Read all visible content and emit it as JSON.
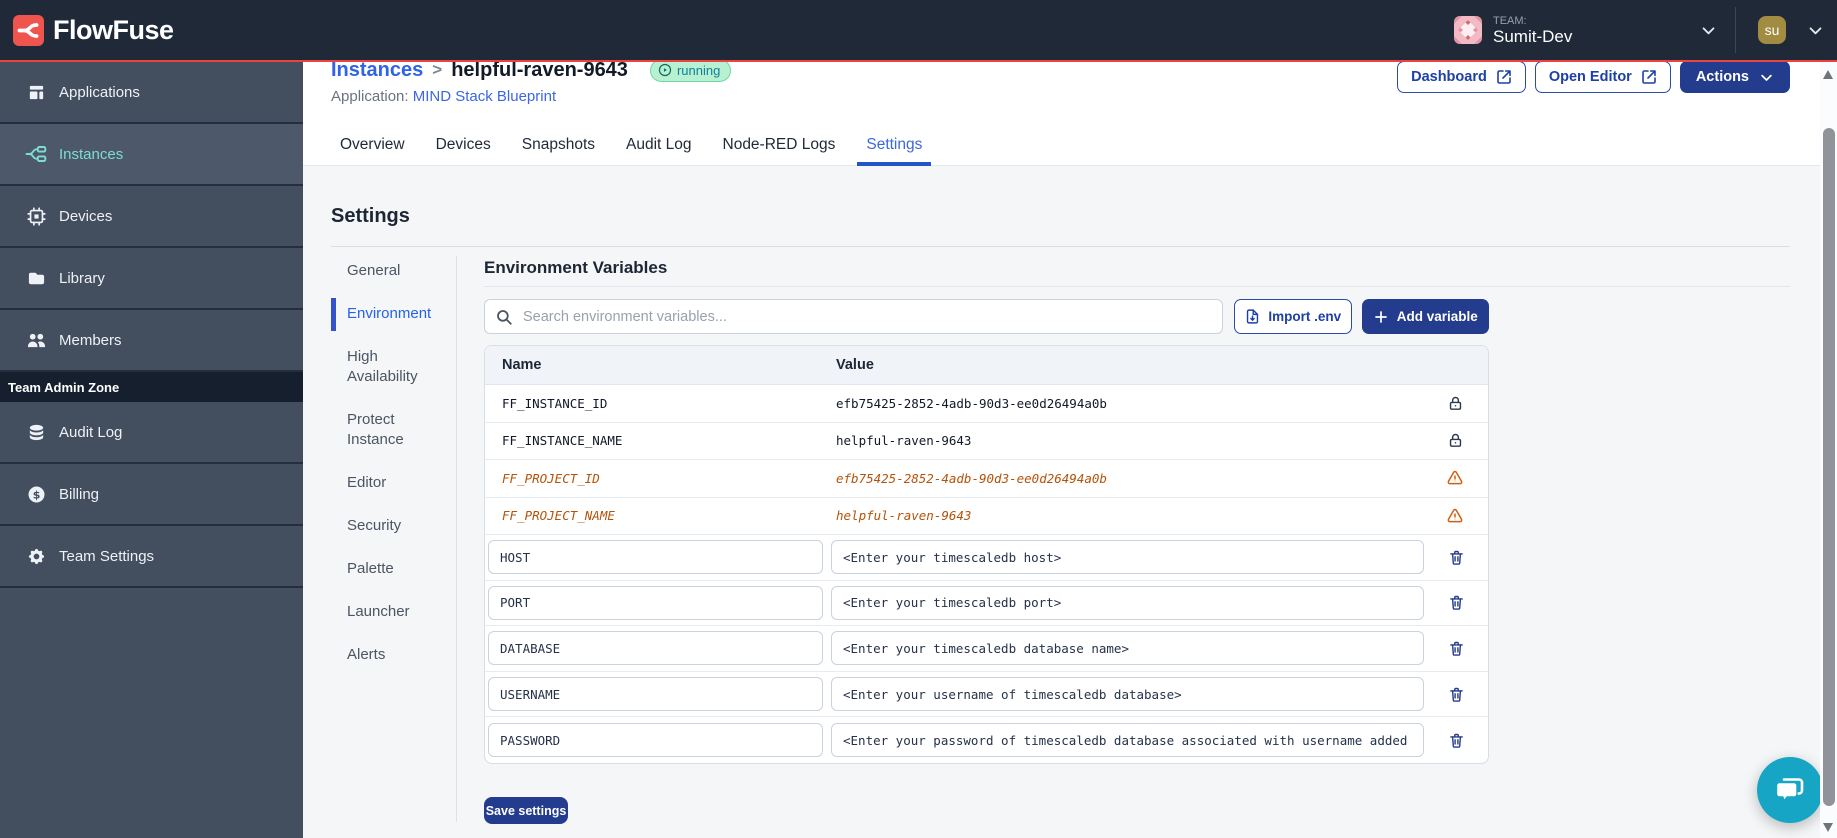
{
  "navbar": {
    "brand": "FlowFuse",
    "team_label": "TEAM:",
    "team_name": "Sumit-Dev",
    "user_initials": "su"
  },
  "sidebar": {
    "items": [
      {
        "label": "Applications"
      },
      {
        "label": "Instances"
      },
      {
        "label": "Devices"
      },
      {
        "label": "Library"
      },
      {
        "label": "Members"
      }
    ],
    "admin_zone_label": "Team Admin Zone",
    "admin_items": [
      {
        "label": "Audit Log"
      },
      {
        "label": "Billing"
      },
      {
        "label": "Team Settings"
      }
    ],
    "active": "Instances"
  },
  "header": {
    "breadcrumb": {
      "parent": "Instances",
      "separator": ">",
      "current": "helpful-raven-9643"
    },
    "status_badge": "running",
    "application_label": "Application:",
    "application_name": "MIND Stack Blueprint",
    "buttons": {
      "dashboard": "Dashboard",
      "open_editor": "Open Editor",
      "actions": "Actions"
    }
  },
  "tabs": {
    "items": [
      {
        "label": "Overview"
      },
      {
        "label": "Devices"
      },
      {
        "label": "Snapshots"
      },
      {
        "label": "Audit Log"
      },
      {
        "label": "Node-RED Logs"
      },
      {
        "label": "Settings"
      }
    ],
    "active": "Settings"
  },
  "settings": {
    "title": "Settings",
    "nav": [
      {
        "label": "General"
      },
      {
        "label": "Environment"
      },
      {
        "label": "High Availability"
      },
      {
        "label": "Protect Instance"
      },
      {
        "label": "Editor"
      },
      {
        "label": "Security"
      },
      {
        "label": "Palette"
      },
      {
        "label": "Launcher"
      },
      {
        "label": "Alerts"
      }
    ],
    "active": "Environment"
  },
  "environment": {
    "title": "Environment Variables",
    "search_placeholder": "Search environment variables...",
    "import_button": "Import .env",
    "add_button": "Add variable",
    "columns": {
      "name": "Name",
      "value": "Value"
    },
    "locked_rows": [
      {
        "name": "FF_INSTANCE_ID",
        "value": "efb75425-2852-4adb-90d3-ee0d26494a0b"
      },
      {
        "name": "FF_INSTANCE_NAME",
        "value": "helpful-raven-9643"
      }
    ],
    "warning_rows": [
      {
        "name": "FF_PROJECT_ID",
        "value": "efb75425-2852-4adb-90d3-ee0d26494a0b"
      },
      {
        "name": "FF_PROJECT_NAME",
        "value": "helpful-raven-9643"
      }
    ],
    "editable_rows": [
      {
        "name": "HOST",
        "value": "<Enter your timescaledb host>"
      },
      {
        "name": "PORT",
        "value": "<Enter your timescaledb port>"
      },
      {
        "name": "DATABASE",
        "value": "<Enter your timescaledb database name>"
      },
      {
        "name": "USERNAME",
        "value": "<Enter your username of timescaledb database>"
      },
      {
        "name": "PASSWORD",
        "value": "<Enter your password of timescaledb database associated with username added"
      }
    ],
    "save_button": "Save settings"
  },
  "colors": {
    "navbar_bg": "#1f2937",
    "accent_red": "#ec4340",
    "sidebar_bg": "#434e5f",
    "sidebar_active_teal": "#7edcd2",
    "link_blue": "#2e64e5",
    "button_navy": "#243c8e",
    "badge_green_bg": "#b7f1d1",
    "warning_orange": "#b45309",
    "chat_cyan": "#17a5c5"
  }
}
